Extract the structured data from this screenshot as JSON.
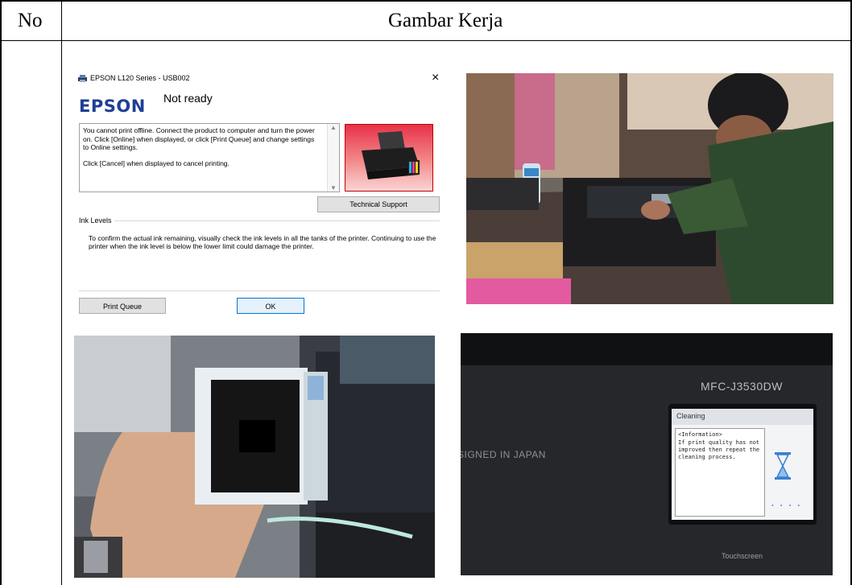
{
  "header": {
    "no_label": "No",
    "title": "Gambar Kerja"
  },
  "dialog": {
    "window_title": "EPSON L120 Series - USB002",
    "close_glyph": "×",
    "logo_text": "EPSON",
    "status": "Not ready",
    "message_line1": "You cannot print offline. Connect the product to computer and turn the power on. Click [Online] when displayed, or click [Print Queue] and change settings to Online settings.",
    "message_line2": "Click [Cancel] when displayed to cancel printing.",
    "technical_support_label": "Technical Support",
    "ink_levels_label": "Ink Levels",
    "ink_levels_text": "To confirm the actual ink remaining, visually check the ink levels in all the tanks of the printer. Continuing to use the printer when the ink level is below the lower limit could damage the printer.",
    "print_queue_label": "Print Queue",
    "ok_label": "OK",
    "logo_color": "#1f3f95"
  },
  "photo_printer_panel": {
    "model": "MFC-J3530DW",
    "brand_text": "SIGNED IN JAPAN",
    "screen_title": "Cleaning",
    "screen_info_header": "<Information>",
    "screen_info_text": "If print quality has not improved then repeat the cleaning process.",
    "touchscreen_label": "Touchscreen"
  }
}
